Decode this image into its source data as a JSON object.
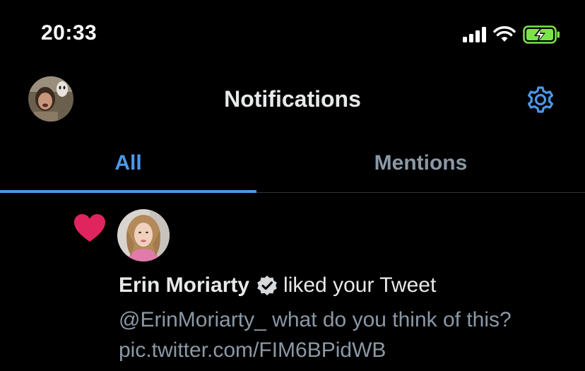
{
  "status_bar": {
    "time": "20:33",
    "icons": [
      "cellular-signal-icon",
      "wifi-icon",
      "battery-charging-icon"
    ]
  },
  "header": {
    "title": "Notifications",
    "avatar_icon": "profile-avatar",
    "settings_icon": "gear-icon"
  },
  "tabs": [
    {
      "label": "All",
      "active": true
    },
    {
      "label": "Mentions",
      "active": false
    }
  ],
  "notifications": [
    {
      "type_icon": "heart-icon",
      "user_name": "Erin Moriarty",
      "verified": true,
      "action": "liked your Tweet",
      "tweet_text": "@ErinMoriarty_ what do you think of this? pic.twitter.com/FIM6BPidWB"
    }
  ],
  "colors": {
    "background": "#000000",
    "accent": "#4a99e9",
    "text_primary": "#e7e9ea",
    "text_secondary": "#8b98a5",
    "like": "#e0245e",
    "battery": "#7ce34a"
  }
}
